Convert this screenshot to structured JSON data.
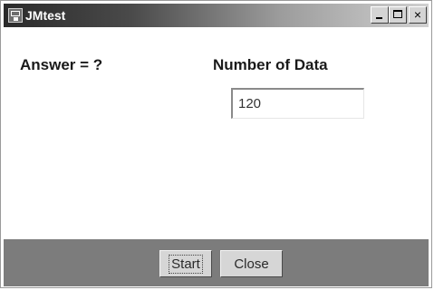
{
  "window": {
    "title": "JMtest",
    "controls": {
      "minimize": "_",
      "maximize": "□",
      "close": "×"
    }
  },
  "main": {
    "answer_label": "Answer = ?",
    "number_label": "Number of Data",
    "number_value": "120"
  },
  "footer": {
    "start_label": "Start",
    "close_label": "Close"
  }
}
